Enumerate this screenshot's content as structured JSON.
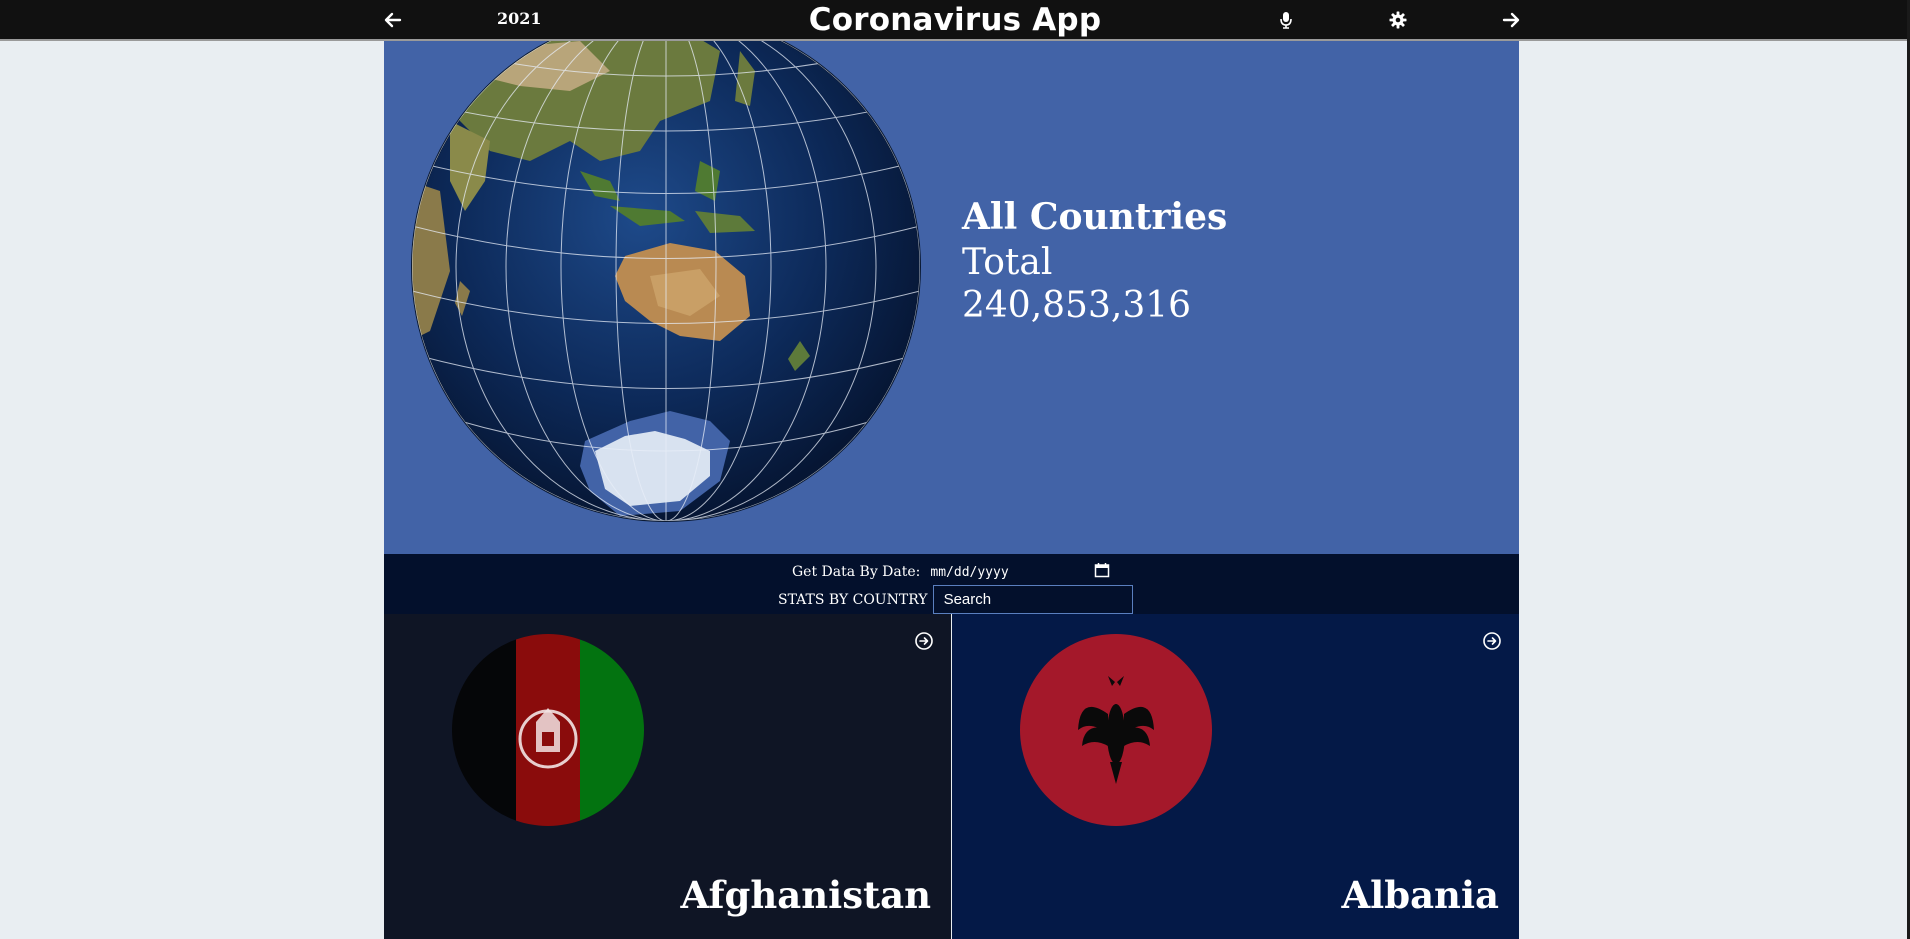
{
  "header": {
    "year": "2021",
    "title": "Coronavirus App",
    "icons": {
      "back": "arrow-left-icon",
      "mic": "microphone-icon",
      "settings": "gear-icon",
      "forward": "arrow-right-icon"
    }
  },
  "hero": {
    "region": "All Countries",
    "total_label": "Total",
    "total_value": "240,853,316",
    "background": "#4263a7"
  },
  "controls": {
    "date_label": "Get Data By Date:",
    "date_placeholder": "mm/dd/yyyy",
    "country_label": "STATS BY COUNTRY",
    "search_placeholder": "Search"
  },
  "countries": [
    {
      "name": "Afghanistan",
      "flag": "afghanistan-flag-icon",
      "background": "#0f1525"
    },
    {
      "name": "Albania",
      "flag": "albania-flag-icon",
      "background": "#041947"
    }
  ]
}
